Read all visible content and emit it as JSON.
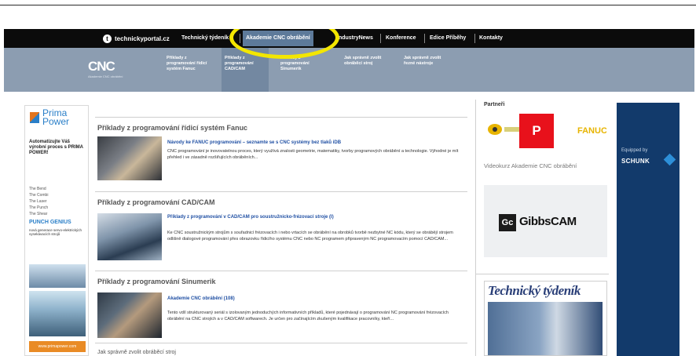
{
  "topnav": {
    "brand": "technickyportal.cz",
    "items": [
      "Technický týdeník",
      "Akademie CNC obrábění",
      "IndustryNews",
      "Konference",
      "Edice Příběhy",
      "Kontakty"
    ]
  },
  "subnav": {
    "logo": "CNC",
    "logo_sub": "Akademie CNC obrábění",
    "items": [
      "Příklady z programování řídicí systém Fanuc",
      "Příklady z programování CAD/CAM",
      "Příklady z programování Sinumerik",
      "Jak správně zvolit obráběcí stroj",
      "Jak správně zvolit řezné nástroje"
    ]
  },
  "left_ad": {
    "brand_line1": "Prima",
    "brand_line2": "Power",
    "headline": "Automatizujte Váš výrobní proces s PRIMA POWER!",
    "list": [
      "The Bend",
      "The Combi",
      "The Laser",
      "The Punch",
      "The Shear"
    ],
    "punch_title": "PUNCH GENIUS",
    "punch_sub": "nová generace servo-elektrických vysekávacích strojů",
    "footer": "www.primapower.com"
  },
  "sections": [
    {
      "title": "Příklady z programování řídicí systém Fanuc",
      "article_title": "Návody ke FANUC programování – seznamte se s CNC systémy bez tlaků iDB",
      "text": "CNC programování je inovovatelnou proces, který využívá znalosti geometrie, matematiky, tvorby programových obrábění a technologie. Výhodné je mít přehled i ve zásadně rozšiřujících obráběních..."
    },
    {
      "title": "Příklady z programování CAD/CAM",
      "article_title": "Příklady z programování v CAD/CAM pro soustružnicko-frézovací stroje (I)",
      "text": "Ke CNC soustružnickým strojům s souřadnicí frézovacích i nebo vrtacích se obrábění na obrobků tvorbě nezbytné NC kódu, který se obrábějí strojem odlišně dialogové programování přes obrazovku řídicího systému CNC nebo NC programem připraveným NC programovacím pomocí CAD/CAM..."
    },
    {
      "title": "Příklady z programování Sinumerik",
      "article_title": "Akademie CNC obrábění (108)",
      "text": "Tento vdíl strukturovaný seriál s izolovaným jednoduchých informativních příkladů, které pojednávají o programování NC programování frézovacích obrábění na CNC strojích a v CAD/CAM softwarech. Je určen pro začínajícím zkušeným kvalifikace pracovníky, kteří..."
    },
    {
      "title": "Jak správně zvolit obráběcí stroj"
    }
  ],
  "sidebar": {
    "partners_label": "Partneři",
    "partner_logo_text": "FANUC",
    "p_icon_label": "P",
    "video_title": "Videokurz Akademie CNC obrábění",
    "gibbs_box": "Gc",
    "gibbs_text": "GibbsCAM",
    "tt_title": "Technický týdeník"
  },
  "right_ad": {
    "small": "Equipped by",
    "brand": "SCHUNK"
  },
  "colors": {
    "topnav_bg": "#0b0b0b",
    "subnav_bg": "#8c9db1",
    "highlight": "#f3e600",
    "p_icon": "#e8111b",
    "schunk_bg": "#123a6b"
  }
}
